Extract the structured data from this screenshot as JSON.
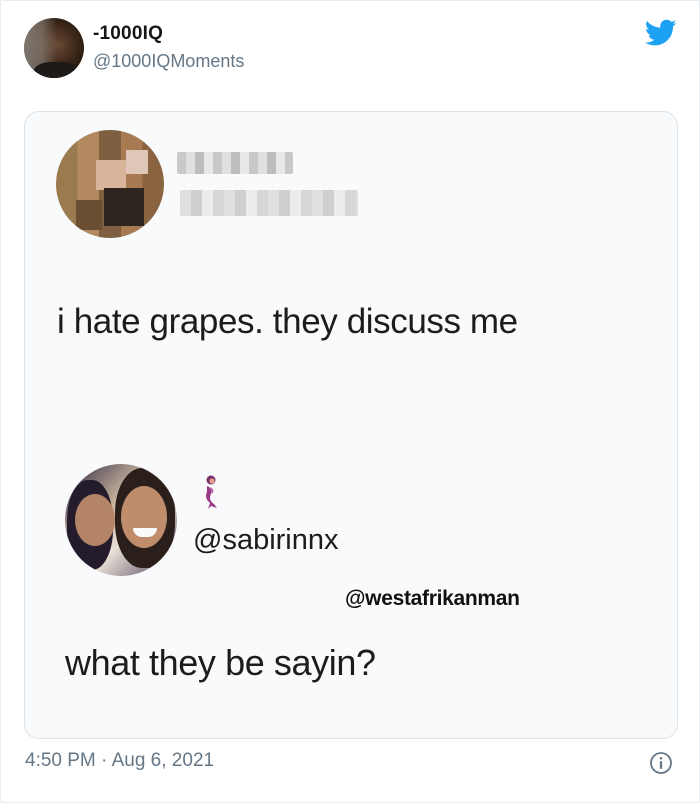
{
  "tweet": {
    "author": {
      "display_name": "-1000IQ",
      "handle": "@1000IQMoments",
      "avatar_icon": "man-with-finger-on-temple-avatar"
    },
    "platform_icon": "twitter-bird-icon",
    "brand_color": "#1da1f2",
    "embedded_image": {
      "original_post": {
        "text": "i hate grapes. they discuss me"
      },
      "reply": {
        "emoji_icon": "mermaid-emoji",
        "handle": "@sabirinnx",
        "text": "what they be sayin?"
      },
      "watermark": "@westafrikanman"
    },
    "timestamp": "4:50 PM · Aug 6, 2021",
    "info_icon": "info-icon"
  }
}
